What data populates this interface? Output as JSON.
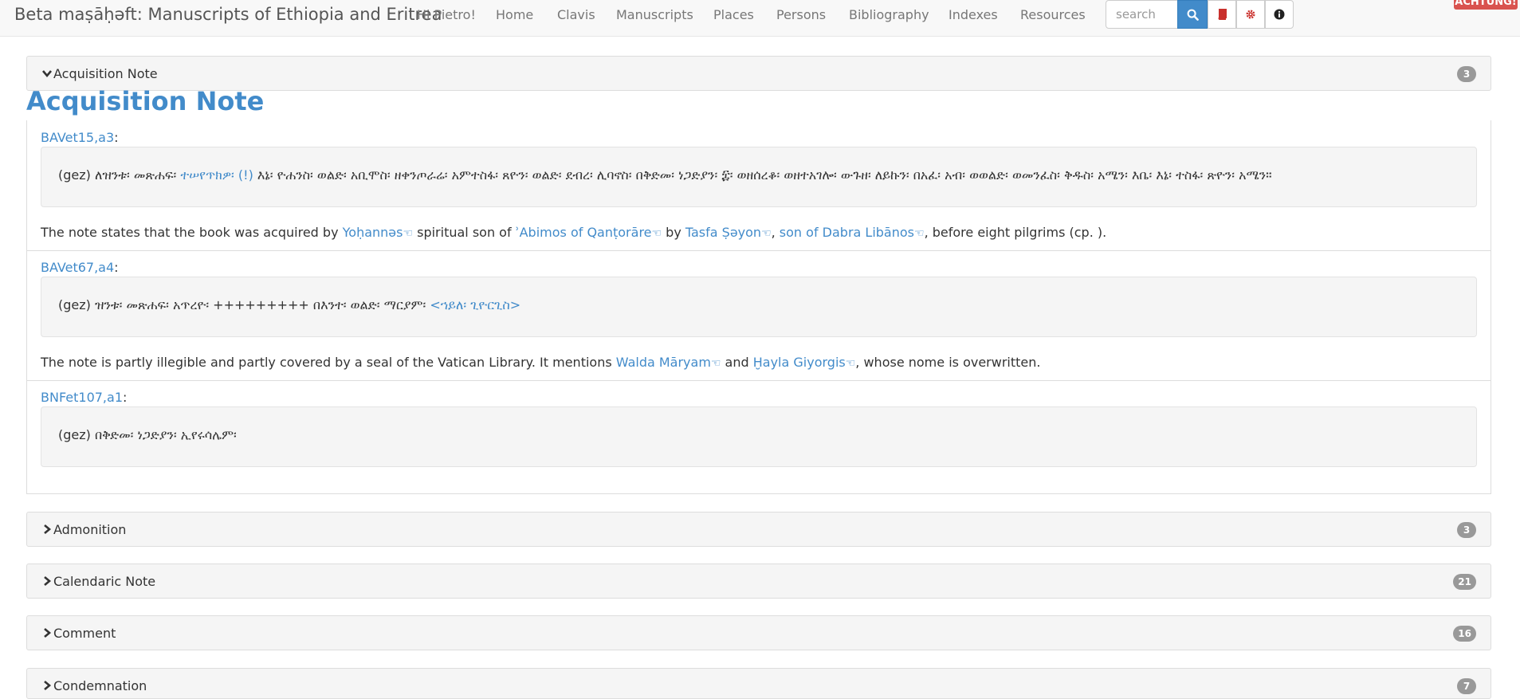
{
  "navbar": {
    "brand": "Beta maṣāḥǝft: Manuscripts of Ethiopia and Eritrea",
    "links": [
      "Hi Pietro!",
      "Home",
      "Clavis",
      "Manuscripts",
      "Places",
      "Persons",
      "Bibliography",
      "Indexes",
      "Resources"
    ],
    "search_placeholder": "search",
    "achtung": "ACHTUNG!"
  },
  "acquisition": {
    "header": "Acquisition Note",
    "count": "3",
    "title": "Acquisition Note",
    "entries": [
      {
        "ref": "BAVet15,a3",
        "colon": ":",
        "ge_prefix": "(gez) ለዝንቱ፡ መጽሐፍ፡ ",
        "ge_link": "ተሠየጥክዎ፡ (!)",
        "ge_suffix": " እኔ፡ ዮሐንስ፡ ወልድ፡ አቢሞስ፡ ዘቀንጦራሬ፡ አምተስፋ፡ ጸዮን፡ ወልድ፡ ደብረ፡ ሊባኖስ፡ በቅድመ፡ ነጋድያን፡ ፰፡ ወዘሰረቆ፡ ወዘተአገሎ፡ ውጉዘ፡ ለይኩን፡ በአፈ፡ አብ፡ ወወልድ፡ ወመንፈስ፡ ቅዱስ፡ አሜን፡ እቤ፡ እኔ፡ ተስፋ፡ ጽዮን፡ አሜን።",
        "note": {
          "t1": "The note states that the book was acquired by ",
          "l1": "Yoḥannǝs",
          "t2": " spiritual son of ",
          "l2": "ʾAbimos of Qanṭorāre",
          "t3": " by ",
          "l3": "Tasfa Ṣǝyon",
          "t4": ", ",
          "l4": "son of Dabra Libānos",
          "t5": ", before eight pilgrims (cp. )."
        }
      },
      {
        "ref": "BAVet67,a4",
        "colon": ":",
        "ge_prefix": "(gez) ዝንቱ፡ መጽሐፍ፡ አጥረዮ፡ +++++++++ በእንተ፡ ወልድ፡ ማርያም፡ ",
        "ge_link": "<ኀይለ፡ ጊዮርጊስ>",
        "note": {
          "t1": "The note is partly illegible and partly covered by a seal of the Vatican Library. It mentions ",
          "l1": "Walda Māryam",
          "t2": " and ",
          "l2": "Ḫayla Giyorgis",
          "t3": ", whose nome is overwritten."
        }
      },
      {
        "ref": "BNFet107,a1",
        "colon": ":",
        "ge_text": "(gez) በቅድመ፡ ነጋድያን፡ ኢየሩሳሌም፡"
      }
    ]
  },
  "panels": [
    {
      "label": "Admonition",
      "count": "3"
    },
    {
      "label": "Calendaric Note",
      "count": "21"
    },
    {
      "label": "Comment",
      "count": "16"
    },
    {
      "label": "Condemnation",
      "count": "7"
    }
  ],
  "colors": {
    "link": "#428bca",
    "badge": "#999999",
    "achtung": "#d9534f"
  }
}
